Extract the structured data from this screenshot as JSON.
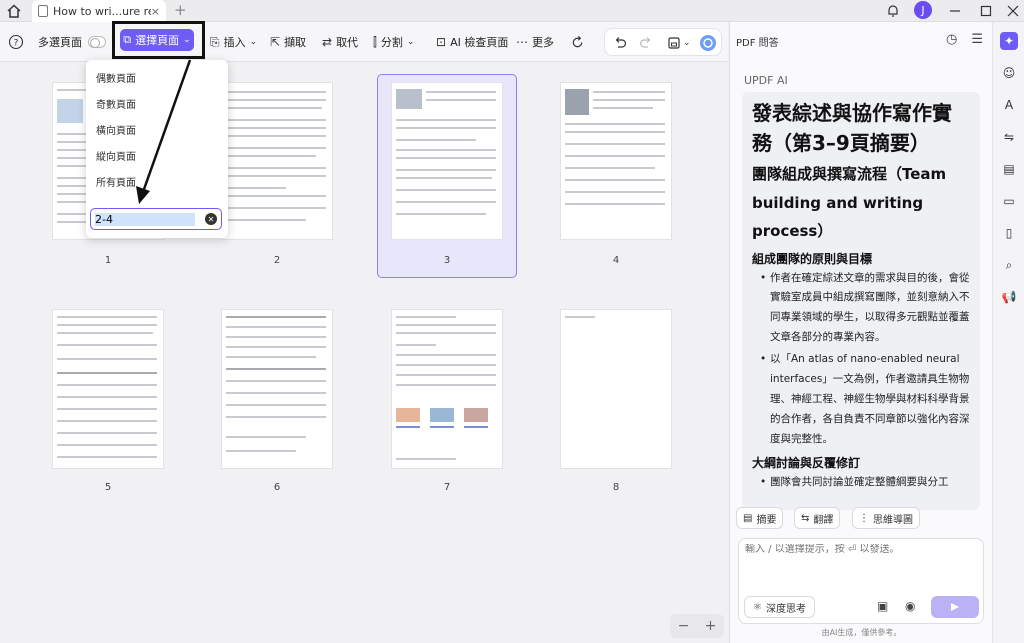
{
  "titlebar": {
    "tab_title": "How to wri...ure review",
    "tab_close": "×",
    "new_tab": "+",
    "avatar_letter": "J"
  },
  "toolbar": {
    "multi_select_label": "多選頁面",
    "select_page_label": "選擇頁面",
    "insert_label": "插入",
    "extract_label": "擷取",
    "replace_label": "取代",
    "split_label": "分割",
    "ai_check_label": "AI 檢查頁面",
    "more_label": "更多"
  },
  "dropdown": {
    "items": [
      "偶數頁面",
      "奇數頁面",
      "橫向頁面",
      "縱向頁面",
      "所有頁面"
    ],
    "range_value": "2-4"
  },
  "pages": {
    "numbers": [
      "1",
      "2",
      "3",
      "4",
      "5",
      "6",
      "7",
      "8"
    ],
    "selected": "3"
  },
  "zoom": {
    "minus": "−",
    "plus": "+"
  },
  "right_panel": {
    "header_title": "PDF 問答",
    "ai_label": "UPDF AI",
    "answer": {
      "title": "發表綜述與協作寫作實務（第3–9頁摘要）",
      "h2": "團隊組成與撰寫流程（Team building and writing process）",
      "h3_1": "組成團隊的原則與目標",
      "bullet_1": "作者在確定綜述文章的需求與目的後，會從實驗室成員中組成撰寫團隊，並刻意納入不同專業領域的學生，以取得多元觀點並覆蓋文章各部分的專業內容。",
      "bullet_2": "以「An atlas of nano-enabled neural interfaces」一文為例，作者邀請具生物物理、神經工程、神經生物學與材料科學背景的合作者，各自負責不同章節以強化內容深度與完整性。",
      "h3_2": "大綱討論與反覆修訂",
      "bullet_3": "團隊會共同討論並確定整體綱要與分工"
    },
    "chips": {
      "summary": "摘要",
      "translate": "翻譯",
      "mindmap": "思維導圖"
    },
    "input_placeholder": "輸入 / 以選擇提示，按 ⏎ 以發送。",
    "deep_think": "深度思考",
    "footnote": "由AI生成，僅供參考。"
  }
}
